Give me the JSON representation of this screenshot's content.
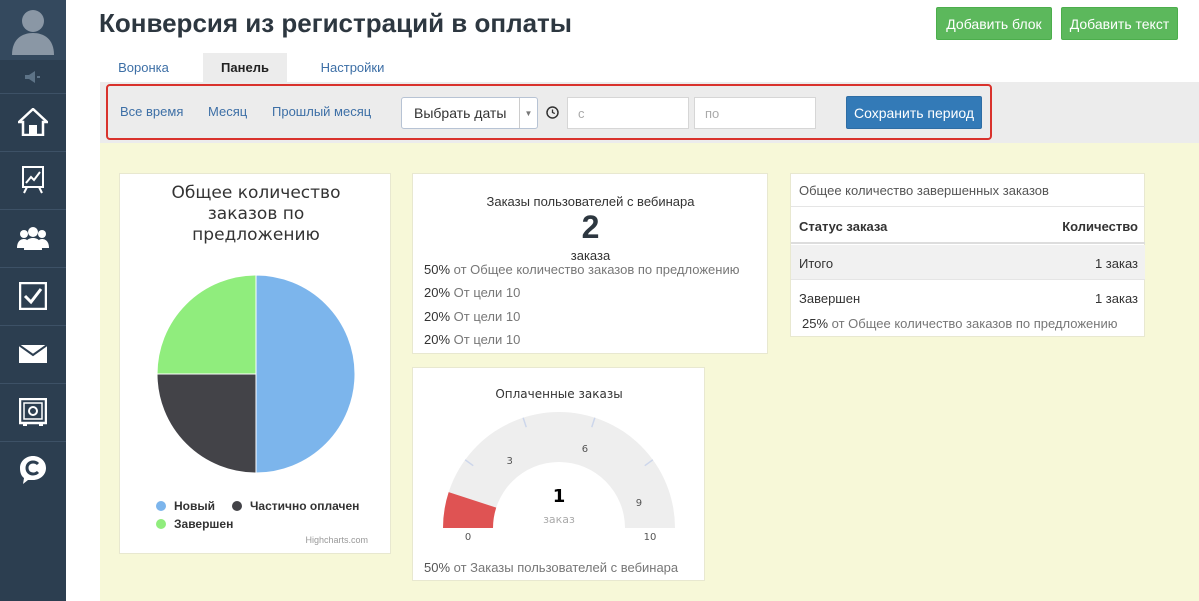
{
  "header": {
    "title": "Конверсия из регистраций в оплаты",
    "add_block": "Добавить блок",
    "add_text": "Добавить текст"
  },
  "tabs": [
    {
      "label": "Воронка"
    },
    {
      "label": "Панель"
    },
    {
      "label": "Настройки"
    }
  ],
  "period": {
    "all_time": "Все время",
    "month": "Месяц",
    "last_month": "Прошлый месяц",
    "select_dates": "Выбрать даты",
    "from_placeholder": "с",
    "to_placeholder": "по",
    "save": "Сохранить период"
  },
  "pie_card": {
    "title_line1": "Общее количество",
    "title_line2": "заказов по",
    "title_line3": "предложению",
    "credit": "Highcharts.com"
  },
  "chart_data": {
    "type": "pie",
    "title": "Общее количество заказов по предложению",
    "series": [
      {
        "name": "Новый",
        "value": 50,
        "color": "#7cb5ec"
      },
      {
        "name": "Частично оплачен",
        "value": 25,
        "color": "#434348"
      },
      {
        "name": "Завершен",
        "value": 25,
        "color": "#90ed7d"
      }
    ]
  },
  "metric_card": {
    "title": "Заказы пользователей с вебинара",
    "value": "2",
    "unit": "заказа",
    "lines": [
      {
        "pct": "50%",
        "label": "от Общее количество заказов по предложению"
      },
      {
        "pct": "20%",
        "label": "От цели 10"
      },
      {
        "pct": "20%",
        "label": "От цели 10"
      },
      {
        "pct": "20%",
        "label": "От цели 10"
      }
    ]
  },
  "table_card": {
    "title": "Общее количество завершенных заказов",
    "col_status": "Статус заказа",
    "col_count": "Количество",
    "rows": [
      {
        "status": "Итого",
        "count": "1 заказ"
      },
      {
        "status": "Завершен",
        "count": "1 заказ"
      }
    ],
    "footer_pct": "25%",
    "footer_label": "от Общее количество заказов по предложению"
  },
  "gauge_card": {
    "title": "Оплаченные заказы",
    "value": "1",
    "unit": "заказ",
    "min": 0,
    "max": 10,
    "current": 1,
    "tick_labels": [
      "0",
      "3",
      "6",
      "9",
      "10"
    ],
    "footer_pct": "50%",
    "footer_label": "от Заказы пользователей с вебинара",
    "colors": {
      "band": "#df5353",
      "track": "#eeeeee"
    }
  },
  "colors": {
    "sidebar": "#2c3e50",
    "green": "#5cb85c",
    "blue": "#337ab7",
    "dashboard_bg": "#f7f8d8",
    "highlight": "#d9322c"
  }
}
